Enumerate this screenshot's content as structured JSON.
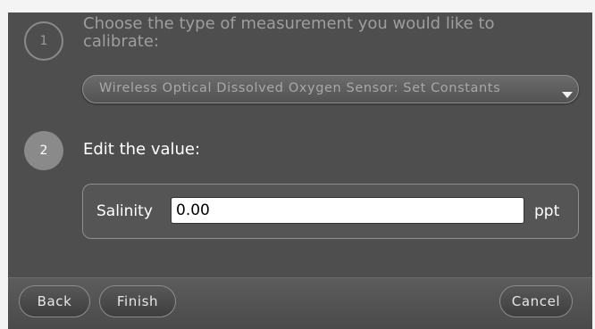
{
  "step1": {
    "number": "1",
    "prompt": "Choose the type of measurement you would like to calibrate:",
    "selected_measurement": "Wireless Optical Dissolved Oxygen Sensor: Set Constants"
  },
  "step2": {
    "number": "2",
    "prompt": "Edit the value:",
    "parameter_label": "Salinity",
    "parameter_value": "0.00",
    "unit": "ppt"
  },
  "footer": {
    "back_label": "Back",
    "finish_label": "Finish",
    "cancel_label": "Cancel"
  }
}
